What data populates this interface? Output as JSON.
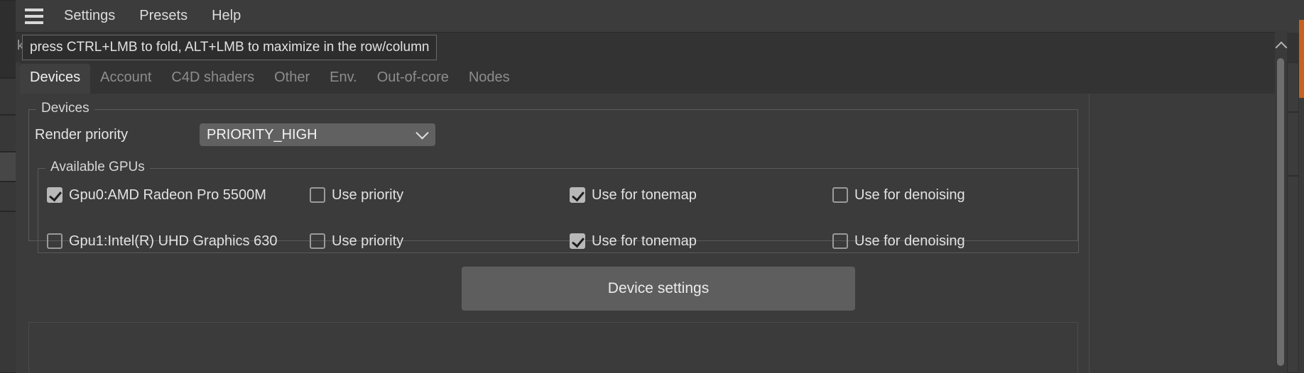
{
  "menubar": {
    "hamburger_icon": "hamburger-icon",
    "items": [
      {
        "label": "Settings"
      },
      {
        "label": "Presets"
      },
      {
        "label": "Help"
      }
    ]
  },
  "subbar": {
    "ghost_text": "k"
  },
  "tooltip": {
    "text": "press CTRL+LMB to fold, ALT+LMB to maximize in the row/column"
  },
  "tabs": [
    {
      "label": "Devices",
      "active": true
    },
    {
      "label": "Account",
      "active": false
    },
    {
      "label": "C4D shaders",
      "active": false
    },
    {
      "label": "Other",
      "active": false
    },
    {
      "label": "Env.",
      "active": false
    },
    {
      "label": "Out-of-core",
      "active": false
    },
    {
      "label": "Nodes",
      "active": false
    }
  ],
  "devices_group": {
    "legend": "Devices",
    "render_priority": {
      "label": "Render priority",
      "value": "PRIORITY_HIGH",
      "chevron_icon": "chevron-down-icon"
    }
  },
  "gpus_group": {
    "legend": "Available GPUs",
    "rows": [
      {
        "name": "Gpu0:AMD Radeon Pro 5500M",
        "enabled": true,
        "use_priority": {
          "label": "Use priority",
          "checked": false
        },
        "use_tonemap": {
          "label": "Use for tonemap",
          "checked": true
        },
        "use_denoising": {
          "label": "Use for denoising",
          "checked": false
        }
      },
      {
        "name": "Gpu1:Intel(R) UHD Graphics 630",
        "enabled": false,
        "use_priority": {
          "label": "Use priority",
          "checked": false
        },
        "use_tonemap": {
          "label": "Use for tonemap",
          "checked": true
        },
        "use_denoising": {
          "label": "Use for denoising",
          "checked": false
        }
      }
    ]
  },
  "device_settings_button": {
    "label": "Device settings"
  },
  "scrollbar": {
    "up_icon": "chevron-up-icon"
  },
  "colors": {
    "window_bg": "#3b3b3b",
    "menubar_bg": "#3c3c3c",
    "tabbar_bg": "#333333",
    "active_tab_bg": "#3f3f3f",
    "text": "#e2e2e2",
    "muted_text": "#8d8d8d",
    "checkbox_on": "#b8b8b8",
    "select_bg": "#616161",
    "button_bg": "#5e5e5e",
    "accent": "#c8601f"
  }
}
